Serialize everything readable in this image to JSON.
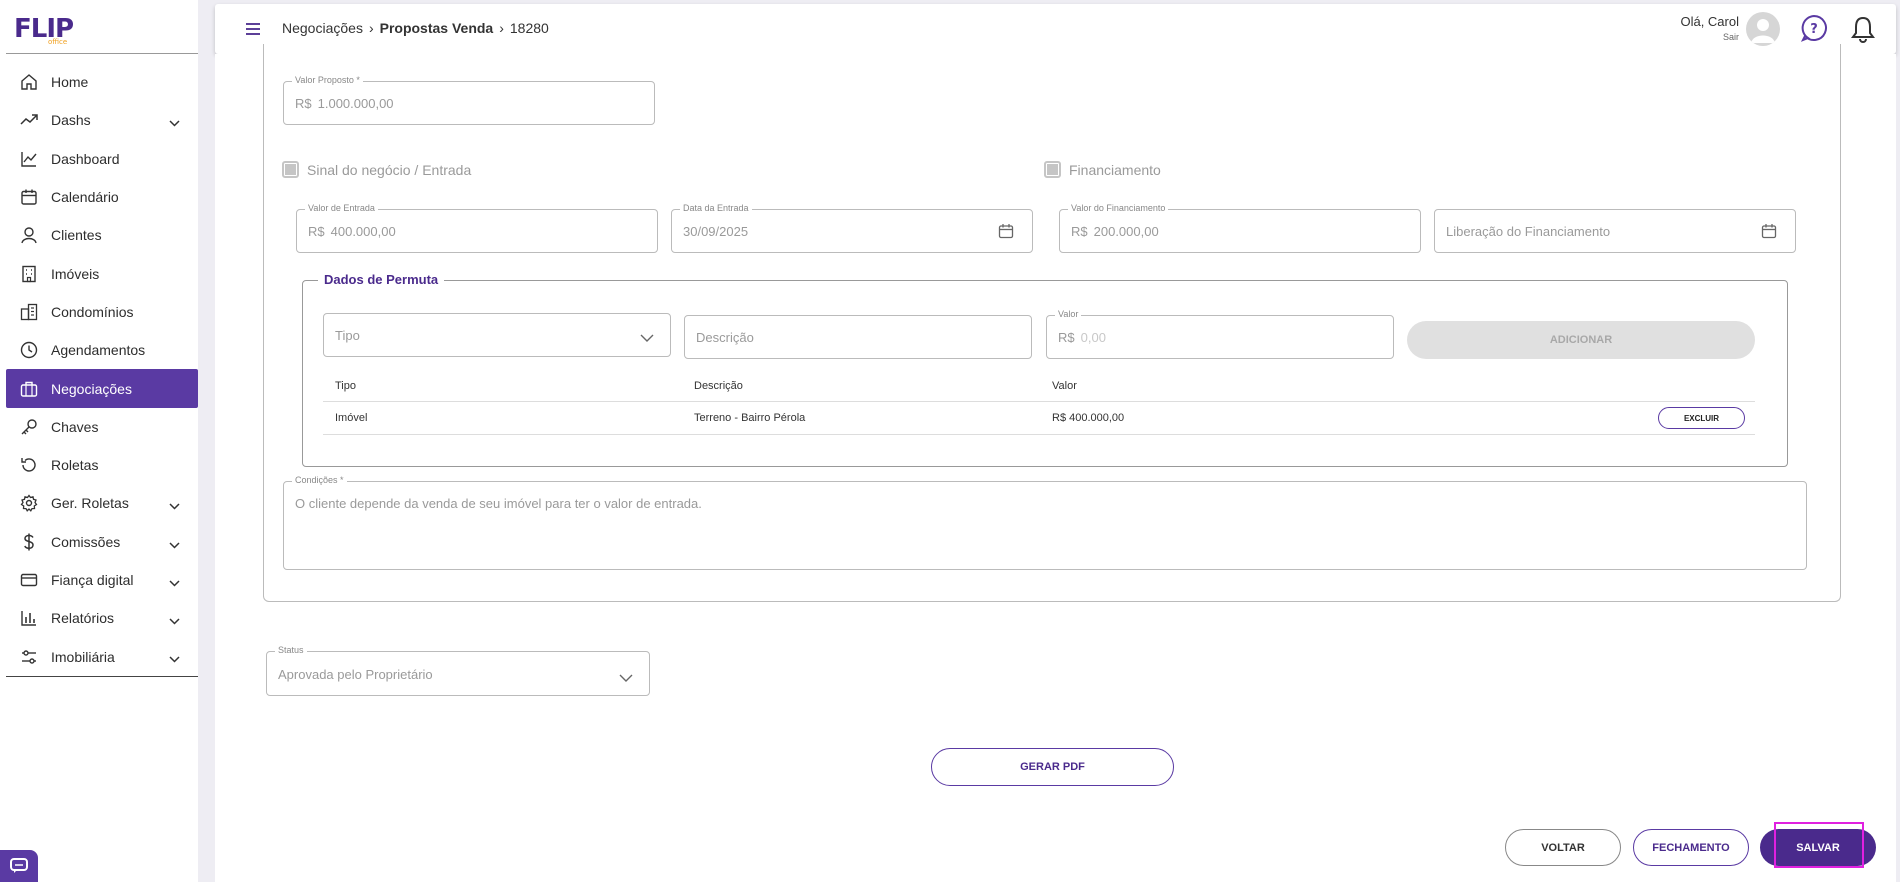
{
  "sidebar": {
    "logo": "FLIP",
    "logo_sub": "office",
    "items": [
      {
        "label": "Home",
        "icon": "home-icon",
        "chevron": false,
        "active": false
      },
      {
        "label": "Dashs",
        "icon": "trend-icon",
        "chevron": true,
        "active": false
      },
      {
        "label": "Dashboard",
        "icon": "line-chart-icon",
        "chevron": false,
        "active": false
      },
      {
        "label": "Calendário",
        "icon": "calendar-icon",
        "chevron": false,
        "active": false
      },
      {
        "label": "Clientes",
        "icon": "user-icon",
        "chevron": false,
        "active": false
      },
      {
        "label": "Imóveis",
        "icon": "building-icon",
        "chevron": false,
        "active": false
      },
      {
        "label": "Condomínios",
        "icon": "buildings-icon",
        "chevron": false,
        "active": false
      },
      {
        "label": "Agendamentos",
        "icon": "clock-icon",
        "chevron": false,
        "active": false
      },
      {
        "label": "Negociações",
        "icon": "briefcase-icon",
        "chevron": false,
        "active": true
      },
      {
        "label": "Chaves",
        "icon": "key-icon",
        "chevron": false,
        "active": false
      },
      {
        "label": "Roletas",
        "icon": "rotate-icon",
        "chevron": false,
        "active": false
      },
      {
        "label": "Ger. Roletas",
        "icon": "gear-icon",
        "chevron": true,
        "active": false
      },
      {
        "label": "Comissões",
        "icon": "dollar-icon",
        "chevron": true,
        "active": false
      },
      {
        "label": "Fiança digital",
        "icon": "credit-card-icon",
        "chevron": true,
        "active": false
      },
      {
        "label": "Relatórios",
        "icon": "bar-chart-icon",
        "chevron": true,
        "active": false
      },
      {
        "label": "Imobiliária",
        "icon": "sliders-icon",
        "chevron": true,
        "active": false
      }
    ]
  },
  "header": {
    "breadcrumb": [
      "Negociações",
      "Propostas Venda",
      "18280"
    ],
    "greeting": "Olá, Carol",
    "logout": "Sair"
  },
  "form": {
    "valor_proposto": {
      "label": "Valor Proposto *",
      "prefix": "R$",
      "value": "1.000.000,00"
    },
    "sinal_checkbox": "Sinal do negócio / Entrada",
    "financiamento_checkbox": "Financiamento",
    "valor_entrada": {
      "label": "Valor de Entrada",
      "prefix": "R$",
      "value": "400.000,00"
    },
    "data_entrada": {
      "label": "Data da Entrada",
      "value": "30/09/2025"
    },
    "valor_financiamento": {
      "label": "Valor do Financiamento",
      "prefix": "R$",
      "value": "200.000,00"
    },
    "liberacao_financiamento": {
      "placeholder": "Liberação do Financiamento"
    },
    "permuta": {
      "title": "Dados de Permuta",
      "tipo_placeholder": "Tipo",
      "descricao_placeholder": "Descrição",
      "valor_label": "Valor",
      "valor_prefix": "R$",
      "valor_placeholder": "0,00",
      "add_label": "ADICIONAR",
      "columns": [
        "Tipo",
        "Descrição",
        "Valor"
      ],
      "rows": [
        {
          "tipo": "Imóvel",
          "descricao": "Terreno - Bairro Pérola",
          "valor": "R$ 400.000,00",
          "action": "EXCLUIR"
        }
      ]
    },
    "condicoes": {
      "label": "Condições *",
      "value": "O cliente depende da venda de seu imóvel para ter o valor de entrada."
    },
    "status": {
      "label": "Status",
      "value": "Aprovada pelo Proprietário"
    }
  },
  "actions": {
    "gerar_pdf": "GERAR PDF",
    "voltar": "VOLTAR",
    "fechamento": "FECHAMENTO",
    "salvar": "SALVAR"
  },
  "colors": {
    "brand": "#4a2a8c",
    "active": "#5a3aa3",
    "highlight": "#e020e0"
  }
}
